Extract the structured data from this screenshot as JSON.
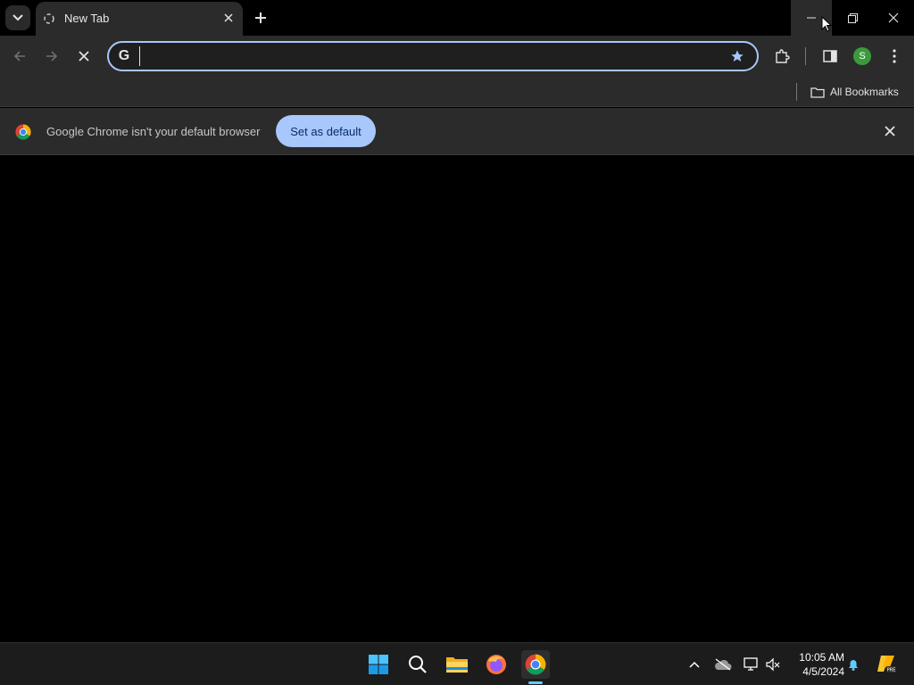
{
  "tabs": [
    {
      "title": "New Tab"
    }
  ],
  "omnibox": {
    "value": "",
    "placeholder": ""
  },
  "bookmarks": {
    "all_label": "All Bookmarks"
  },
  "profile": {
    "initial": "S"
  },
  "infobar": {
    "message": "Google Chrome isn't your default browser",
    "button_label": "Set as default"
  },
  "taskbar": {
    "time": "10:05 AM",
    "date": "4/5/2024",
    "apps": [
      "windows-start-icon",
      "search-icon",
      "file-explorer-icon",
      "firefox-icon",
      "chrome-icon"
    ]
  },
  "colors": {
    "accent": "#a8c7fa",
    "toolbar": "#2b2b2b",
    "taskbar_indicator": "#60cdff"
  }
}
